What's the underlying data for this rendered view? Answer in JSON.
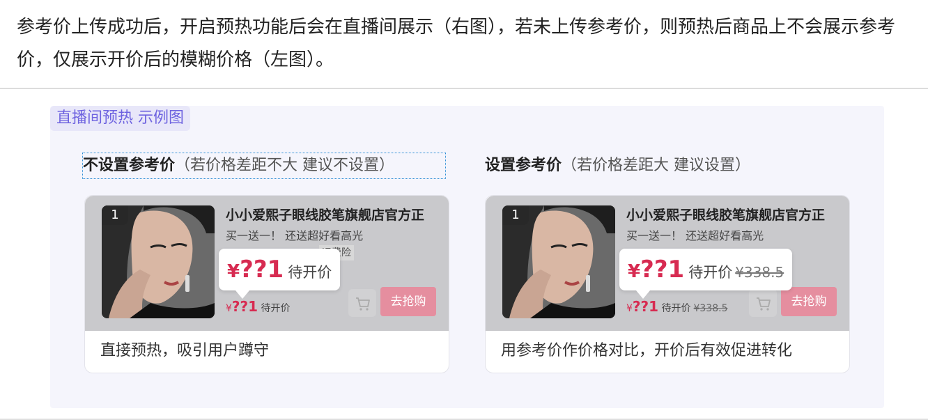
{
  "intro": {
    "text": "参考价上传成功后，开启预热功能后会在直播间展示（右图），若未上传参考价，则预热后商品上不会展示参考价，仅展示开价后的模糊价格（左图）。"
  },
  "example_tag": "直播间预热 示例图",
  "left": {
    "title_bold": "不设置参考价",
    "title_sub": "（若价格差距不大 建议不设置）",
    "card": {
      "rank": "1",
      "product_title": "小小爱熙子眼线胶笔旗舰店官方正",
      "product_subtitle": "买一送一！ 还送超好看高光",
      "insurance_tag": "运费险",
      "bubble_yen": "¥",
      "bubble_price": "??1",
      "bubble_waiting": "待开价",
      "small_yen": "¥",
      "small_price": "??1",
      "small_waiting": "待开价",
      "buy_button": "去抢购"
    },
    "note": "直接预热，吸引用户蹲守"
  },
  "right": {
    "title_bold": "设置参考价",
    "title_sub": "（若价格差距大 建议设置）",
    "card": {
      "rank": "1",
      "product_title": "小小爱熙子眼线胶笔旗舰店官方正",
      "product_subtitle": "买一送一！ 还送超好看高光",
      "bubble_yen": "¥",
      "bubble_price": "??1",
      "bubble_waiting": "待开价",
      "bubble_reference": "¥338.5",
      "small_yen": "¥",
      "small_price": "??1",
      "small_waiting": "待开价",
      "small_reference": "¥338.5",
      "buy_button": "去抢购"
    },
    "note": "用参考价作价格对比，开价后有效促进转化"
  },
  "colors": {
    "accent": "#6e63e0",
    "price_red": "#d72b51",
    "buy_button": "#e58e9f",
    "panel_bg": "#f5f5fc"
  },
  "icons": [
    "cart-icon",
    "model-photo"
  ]
}
